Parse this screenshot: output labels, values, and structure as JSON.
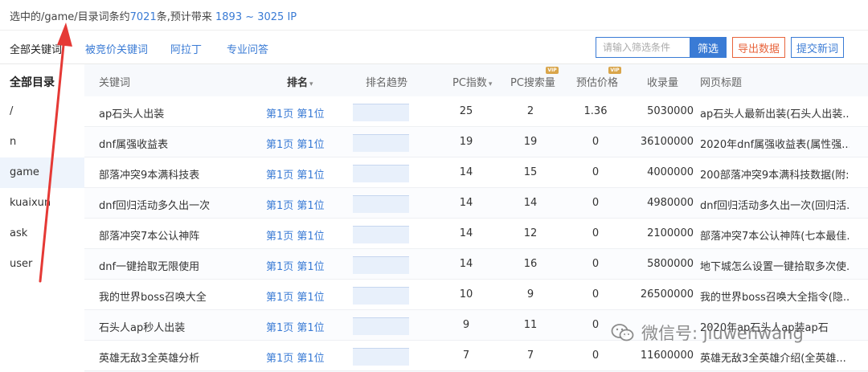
{
  "summary": {
    "prefix": "选中的/game/目录词条约",
    "count": "7021",
    "middle": "条,预计带来 ",
    "range": "1893 ~ 3025 IP"
  },
  "tabs": [
    {
      "label": "全部关键词",
      "active": true
    },
    {
      "label": "被竞价关键词",
      "active": false
    },
    {
      "label": "阿拉丁",
      "active": false
    },
    {
      "label": "专业问答",
      "active": false
    }
  ],
  "filter": {
    "placeholder": "请输入筛选条件",
    "filter_label": "筛选",
    "export_label": "导出数据",
    "submit_label": "提交新词"
  },
  "sidebar": {
    "title": "全部目录",
    "items": [
      {
        "label": "/",
        "active": false
      },
      {
        "label": "n",
        "active": false
      },
      {
        "label": "game",
        "active": true
      },
      {
        "label": "kuaixun",
        "active": false
      },
      {
        "label": "ask",
        "active": false
      },
      {
        "label": "user",
        "active": false
      }
    ]
  },
  "table": {
    "headers": {
      "keyword": "关键词",
      "rank": "排名",
      "trend": "排名趋势",
      "pc_index": "PC指数",
      "pc_volume": "PC搜索量",
      "est_price": "预估价格",
      "indexed": "收录量",
      "page_title": "网页标题",
      "vip": "VIP"
    },
    "rows": [
      {
        "keyword": "ap石头人出装",
        "rank": "第1页 第1位",
        "pc_index": "25",
        "pc_volume": "2",
        "est_price": "1.36",
        "indexed": "5030000",
        "page_title": "ap石头人最新出装(石头人出装..."
      },
      {
        "keyword": "dnf属强收益表",
        "rank": "第1页 第1位",
        "pc_index": "19",
        "pc_volume": "19",
        "est_price": "0",
        "indexed": "36100000",
        "page_title": "2020年dnf属强收益表(属性强..."
      },
      {
        "keyword": "部落冲突9本满科技表",
        "rank": "第1页 第1位",
        "pc_index": "14",
        "pc_volume": "15",
        "est_price": "0",
        "indexed": "4000000",
        "page_title": "200部落冲突9本满科技数据(附:..."
      },
      {
        "keyword": "dnf回归活动多久出一次",
        "rank": "第1页 第1位",
        "pc_index": "14",
        "pc_volume": "14",
        "est_price": "0",
        "indexed": "4980000",
        "page_title": "dnf回归活动多久出一次(回归活..."
      },
      {
        "keyword": "部落冲突7本公认神阵",
        "rank": "第1页 第1位",
        "pc_index": "14",
        "pc_volume": "12",
        "est_price": "0",
        "indexed": "2100000",
        "page_title": "部落冲突7本公认神阵(七本最佳..."
      },
      {
        "keyword": "dnf一键拾取无限使用",
        "rank": "第1页 第1位",
        "pc_index": "14",
        "pc_volume": "16",
        "est_price": "0",
        "indexed": "5800000",
        "page_title": "地下城怎么设置一键拾取多次使..."
      },
      {
        "keyword": "我的世界boss召唤大全",
        "rank": "第1页 第1位",
        "pc_index": "10",
        "pc_volume": "9",
        "est_price": "0",
        "indexed": "26500000",
        "page_title": "我的世界boss召唤大全指令(隐..."
      },
      {
        "keyword": "石头人ap秒人出装",
        "rank": "第1页 第1位",
        "pc_index": "9",
        "pc_volume": "11",
        "est_price": "0",
        "indexed": "",
        "page_title": "2020年ap石头人ap装ap石"
      },
      {
        "keyword": "英雄无敌3全英雄分析",
        "rank": "第1页 第1位",
        "pc_index": "7",
        "pc_volume": "7",
        "est_price": "0",
        "indexed": "11600000",
        "page_title": "英雄无敌3全英雄介绍(全英雄..."
      }
    ]
  },
  "watermark": {
    "text": "微信号: jiuwenwang"
  },
  "colors": {
    "accent": "#3a7bd5",
    "export": "#e8643c",
    "arrow": "#e53935"
  }
}
